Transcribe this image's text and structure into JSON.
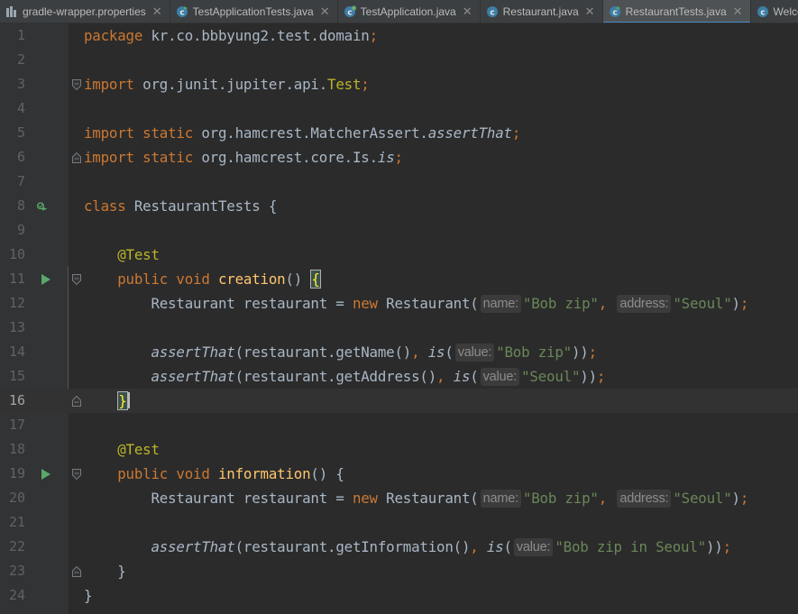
{
  "tabs": [
    {
      "label": "gradle-wrapper.properties",
      "icon": "properties-file-icon",
      "active": false
    },
    {
      "label": "TestApplicationTests.java",
      "icon": "test-class-icon",
      "active": false
    },
    {
      "label": "TestApplication.java",
      "icon": "spring-class-icon",
      "active": false
    },
    {
      "label": "Restaurant.java",
      "icon": "class-icon",
      "active": false
    },
    {
      "label": "RestaurantTests.java",
      "icon": "test-class-icon",
      "active": true
    },
    {
      "label": "Welcom",
      "icon": "class-icon",
      "active": false
    }
  ],
  "editor": {
    "current_line": 16,
    "lines": [
      {
        "n": "1",
        "html": "<span class=\"kw\">package</span> kr.co.bbbyung2.test.domain<span class=\"kw\">;</span>"
      },
      {
        "n": "2",
        "html": ""
      },
      {
        "n": "3",
        "html": "<span class=\"kw\">import</span> org.junit.jupiter.api.<span class=\"ann\">Test</span><span class=\"kw\">;</span>"
      },
      {
        "n": "4",
        "html": ""
      },
      {
        "n": "5",
        "html": "<span class=\"kw\">import static</span> org.hamcrest.MatcherAssert.<span class=\"it\">assertThat</span><span class=\"kw\">;</span>"
      },
      {
        "n": "6",
        "html": "<span class=\"kw\">import static</span> org.hamcrest.core.Is.<span class=\"it\">is</span><span class=\"kw\">;</span>"
      },
      {
        "n": "7",
        "html": ""
      },
      {
        "n": "8",
        "html": "<span class=\"kw\">class</span> RestaurantTests {"
      },
      {
        "n": "9",
        "html": ""
      },
      {
        "n": "10",
        "html": "    <span class=\"ann\">@Test</span>"
      },
      {
        "n": "11",
        "html": "    <span class=\"kw\">public void</span> <span class=\"fn\">creation</span>() <span class=\"brace-hl\">{</span>"
      },
      {
        "n": "12",
        "html": "        Restaurant restaurant = <span class=\"kw\">new</span> Restaurant(<span class=\"hint\">name:</span><span class=\"str\">\"Bob zip\"</span><span class=\"kw\">,</span> <span class=\"hint\">address:</span><span class=\"str\">\"Seoul\"</span>)<span class=\"kw\">;</span>"
      },
      {
        "n": "13",
        "html": ""
      },
      {
        "n": "14",
        "html": "        <span class=\"it\">assertThat</span>(restaurant.getName()<span class=\"kw\">,</span> <span class=\"it\">is</span>(<span class=\"hint\">value:</span><span class=\"str\">\"Bob zip\"</span>))<span class=\"kw\">;</span>"
      },
      {
        "n": "15",
        "html": "        <span class=\"it\">assertThat</span>(restaurant.getAddress()<span class=\"kw\">,</span> <span class=\"it\">is</span>(<span class=\"hint\">value:</span><span class=\"str\">\"Seoul\"</span>))<span class=\"kw\">;</span>"
      },
      {
        "n": "16",
        "html": "    <span class=\"brace-hl\">}</span><span class=\"caret\"></span>"
      },
      {
        "n": "17",
        "html": ""
      },
      {
        "n": "18",
        "html": "    <span class=\"ann\">@Test</span>"
      },
      {
        "n": "19",
        "html": "    <span class=\"kw\">public void</span> <span class=\"fn\">information</span>() {"
      },
      {
        "n": "20",
        "html": "        Restaurant restaurant = <span class=\"kw\">new</span> Restaurant(<span class=\"hint\">name:</span><span class=\"str\">\"Bob zip\"</span><span class=\"kw\">,</span> <span class=\"hint\">address:</span><span class=\"str\">\"Seoul\"</span>)<span class=\"kw\">;</span>"
      },
      {
        "n": "21",
        "html": ""
      },
      {
        "n": "22",
        "html": "        <span class=\"it\">assertThat</span>(restaurant.getInformation()<span class=\"kw\">,</span> <span class=\"it\">is</span>(<span class=\"hint\">value:</span><span class=\"str\">\"Bob zip in Seoul\"</span>))<span class=\"kw\">;</span>"
      },
      {
        "n": "23",
        "html": "    }"
      },
      {
        "n": "24",
        "html": "}"
      }
    ],
    "run_markers": [
      {
        "line": 8,
        "icon": "run-tests-class-icon"
      },
      {
        "line": 11,
        "icon": "run-test-icon"
      },
      {
        "line": 19,
        "icon": "run-test-icon"
      }
    ],
    "fold_markers": [
      {
        "line": 3,
        "icon": "fold-start-icon"
      },
      {
        "line": 6,
        "icon": "fold-end-icon"
      },
      {
        "line": 11,
        "icon": "fold-start-icon"
      },
      {
        "line": 16,
        "icon": "fold-end-icon"
      },
      {
        "line": 19,
        "icon": "fold-start-icon"
      },
      {
        "line": 23,
        "icon": "fold-end-icon"
      }
    ]
  },
  "colors": {
    "background": "#2b2b2b",
    "gutter": "#313335",
    "keyword": "#cc7832",
    "string": "#6a8759",
    "annotation": "#bbb529",
    "method": "#ffc66d",
    "text": "#a9b7c6",
    "active_tab_underline": "#4a88c7"
  }
}
